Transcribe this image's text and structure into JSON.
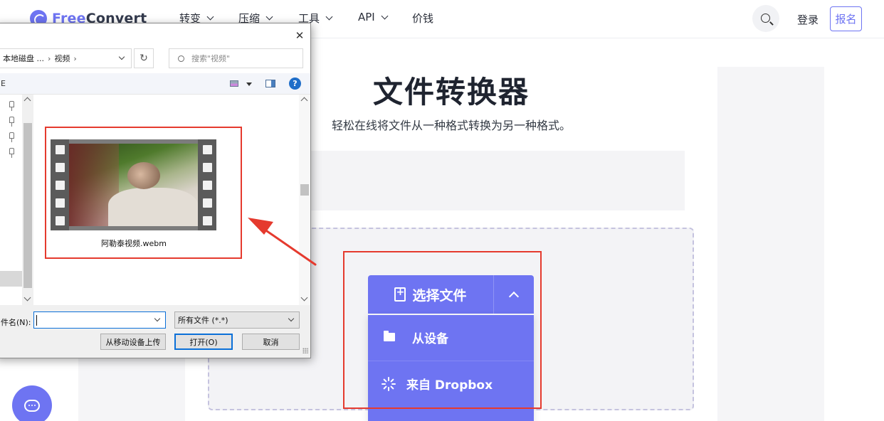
{
  "header": {
    "logo_text_a": "Free",
    "logo_text_b": "Convert",
    "nav": [
      {
        "label": "转变"
      },
      {
        "label": "压缩"
      },
      {
        "label": "工具"
      },
      {
        "label": "API"
      },
      {
        "label": "价钱"
      }
    ],
    "login_label": "登录",
    "signup_label": "报名"
  },
  "hero": {
    "title": "文件转换器",
    "subtitle": "轻松在线将文件从一种格式转换为另一种格式。"
  },
  "uploader": {
    "choose_label": "选择文件",
    "menu": [
      {
        "label": "从设备",
        "icon": "folder-icon"
      },
      {
        "label": "来自 Dropbox",
        "icon": "dropbox-spinner-icon"
      }
    ]
  },
  "file_dialog": {
    "close_glyph": "✕",
    "breadcrumb": [
      "本地磁盘 ...",
      "视频"
    ],
    "breadcrumb_sep": "›",
    "refresh_glyph": "↻",
    "search_placeholder": "搜索\"视频\"",
    "command_fragment": "E",
    "help_glyph": "?",
    "file": {
      "name": "阿勒泰视频.webm"
    },
    "filename_label": "件名(N):",
    "filename_value": "",
    "filetype_value": "所有文件 (*.*)",
    "mobile_upload_label": "从移动设备上传",
    "open_label": "打开(O)",
    "cancel_label": "取消"
  },
  "annotation": {
    "color": "#e53a2e"
  },
  "colors": {
    "accent": "#6e74f2",
    "page_bg": "#ffffff"
  }
}
